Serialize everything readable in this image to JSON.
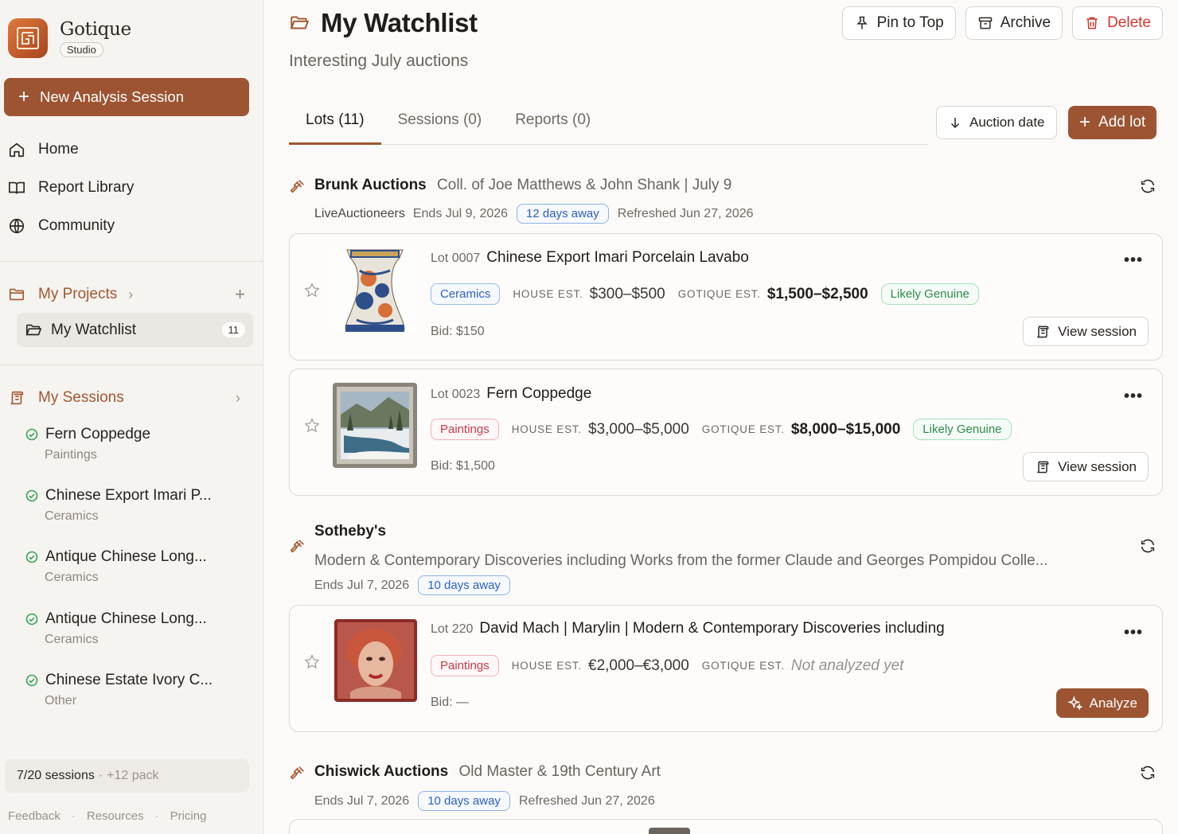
{
  "brand": {
    "name": "Gotique",
    "badge": "Studio"
  },
  "sidebar": {
    "new_session_label": "New Analysis Session",
    "nav": [
      {
        "label": "Home",
        "icon": "home-icon"
      },
      {
        "label": "Report Library",
        "icon": "book-icon"
      },
      {
        "label": "Community",
        "icon": "globe-icon"
      }
    ],
    "projects": {
      "heading": "My Projects",
      "active": {
        "label": "My Watchlist",
        "count": "11"
      }
    },
    "sessions": {
      "heading": "My Sessions",
      "items": [
        {
          "title": "Fern Coppedge",
          "category": "Paintings"
        },
        {
          "title": "Chinese Export Imari P...",
          "category": "Ceramics"
        },
        {
          "title": "Antique Chinese Long...",
          "category": "Ceramics"
        },
        {
          "title": "Antique Chinese Long...",
          "category": "Ceramics"
        },
        {
          "title": "Chinese Estate Ivory C...",
          "category": "Other"
        }
      ]
    },
    "quota": {
      "used": "7/20 sessions",
      "extra": "+12 pack"
    },
    "footer": [
      "Feedback",
      "Resources",
      "Pricing"
    ]
  },
  "header": {
    "title": "My Watchlist",
    "subtitle": "Interesting July auctions",
    "actions": {
      "pin": "Pin to Top",
      "archive": "Archive",
      "delete": "Delete"
    }
  },
  "tabs": [
    {
      "label": "Lots (11)",
      "active": true
    },
    {
      "label": "Sessions (0)",
      "active": false
    },
    {
      "label": "Reports (0)",
      "active": false
    }
  ],
  "toolbar": {
    "sort_label": "Auction date",
    "add_label": "Add lot"
  },
  "labels": {
    "house_est": "HOUSE EST.",
    "gotique_est": "GOTIQUE EST.",
    "view_session": "View session",
    "analyze": "Analyze"
  },
  "auctions": [
    {
      "house": "Brunk Auctions",
      "sale": "Coll. of Joe Matthews & John Shank | July 9",
      "platform": "LiveAuctioneers",
      "ends": "Ends Jul 9, 2026",
      "countdown": "12 days away",
      "refreshed": "Refreshed Jun 27, 2026",
      "lots": [
        {
          "lot": "Lot 0007",
          "title": "Chinese Export Imari Porcelain Lavabo",
          "category": "Ceramics",
          "house_est": "$300–$500",
          "gotique_est": "$1,500–$2,500",
          "verdict": "Likely Genuine",
          "bid": "Bid: $150"
        },
        {
          "lot": "Lot 0023",
          "title": "Fern Coppedge",
          "category": "Paintings",
          "house_est": "$3,000–$5,000",
          "gotique_est": "$8,000–$15,000",
          "verdict": "Likely Genuine",
          "bid": "Bid: $1,500"
        }
      ]
    },
    {
      "house": "Sotheby's",
      "sale": "Modern & Contemporary Discoveries including Works from the former Claude and Georges Pompidou Colle...",
      "ends": "Ends Jul 7, 2026",
      "countdown": "10 days away",
      "lots": [
        {
          "lot": "Lot 220",
          "title": "David Mach | Marylin | Modern & Contemporary Discoveries including",
          "category": "Paintings",
          "house_est": "€2,000–€3,000",
          "gotique_est": "Not analyzed yet",
          "bid": "Bid: —"
        }
      ]
    },
    {
      "house": "Chiswick Auctions",
      "sale": "Old Master & 19th Century Art",
      "ends": "Ends Jul 7, 2026",
      "countdown": "10 days away",
      "refreshed": "Refreshed Jun 27, 2026"
    }
  ],
  "colors": {
    "accent": "#9c5432",
    "accent_text": "#a3562f",
    "danger": "#d2372c",
    "info": "#2c5fc4",
    "success": "#2f8a4b"
  }
}
